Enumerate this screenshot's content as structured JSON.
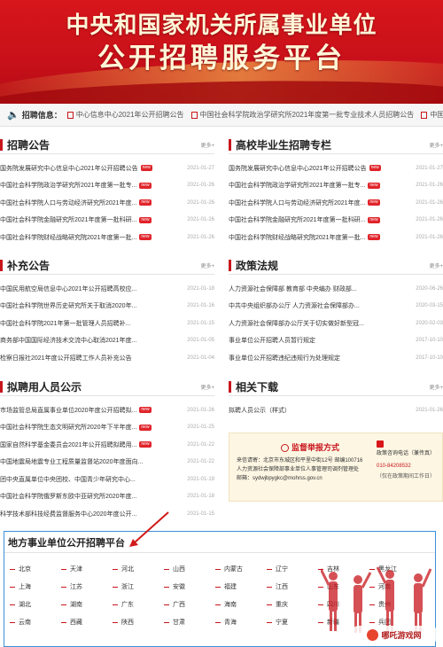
{
  "banner": {
    "line1": "中央和国家机关所属事业单位",
    "line2": "公开招聘服务平台"
  },
  "notice": {
    "label": "招聘信息：",
    "items": [
      "中心信息中心2021年公开招聘公告",
      "中国社会科学院政治学研究所2021年度第一批专业技术人员招聘公告",
      "中国社会科学院人口..."
    ]
  },
  "sections": {
    "recruit": {
      "title": "招聘公告",
      "more": "更多+",
      "rows": [
        {
          "text": "国务院发展研究中心信息中心2021年公开招聘公告",
          "badge": "new",
          "date": "2021-01-27"
        },
        {
          "text": "中国社会科学院政治学研究所2021年度第一批专...",
          "badge": "new",
          "date": "2021-01-26"
        },
        {
          "text": "中国社会科学院人口与劳动经济研究所2021年度...",
          "badge": "new",
          "date": "2021-01-26"
        },
        {
          "text": "中国社会科学院金融研究所2021年度第一批科研...",
          "badge": "new",
          "date": "2021-01-26"
        },
        {
          "text": "中国社会科学院财经战略研究院2021年度第一批...",
          "badge": "new",
          "date": "2021-01-26"
        }
      ]
    },
    "graduate": {
      "title": "高校毕业生招聘专栏",
      "more": "更多+",
      "rows": [
        {
          "text": "国务院发展研究中心信息中心2021年公开招聘公告",
          "badge": "new",
          "date": "2021-01-27"
        },
        {
          "text": "中国社会科学院政治学研究所2021年度第一批专...",
          "badge": "new",
          "date": "2021-01-26"
        },
        {
          "text": "中国社会科学院人口与劳动经济研究所2021年度...",
          "badge": "new",
          "date": "2021-01-26"
        },
        {
          "text": "中国社会科学院金融研究所2021年度第一批科研...",
          "badge": "new",
          "date": "2021-01-26"
        },
        {
          "text": "中国社会科学院财经战略研究院2021年度第一批...",
          "badge": "new",
          "date": "2021-01-26"
        }
      ]
    },
    "supplement": {
      "title": "补充公告",
      "more": "更多+",
      "rows": [
        {
          "text": "中国民用航空局信息中心2021年公开招聘高校应...",
          "badge": "",
          "date": "2021-01-18"
        },
        {
          "text": "中国社会科学院世界历史研究所关于取消2020年...",
          "badge": "",
          "date": "2021-01-16"
        },
        {
          "text": "中国社会科学院2021年第一批管理人员招聘补...",
          "badge": "",
          "date": "2021-01-15"
        },
        {
          "text": "商务部中国国际经济技术交流中心取消2021年度...",
          "badge": "",
          "date": "2021-01-05"
        },
        {
          "text": "检察日报社2021年度公开招聘工作人员补充公告",
          "badge": "",
          "date": "2021-01-04"
        }
      ]
    },
    "policy": {
      "title": "政策法规",
      "more": "更多+",
      "rows": [
        {
          "text": "人力资源社会保障部 教育部 中央编办 财政部...",
          "badge": "",
          "date": "2020-06-26"
        },
        {
          "text": "中共中央组织部办公厅 人力资源社会保障部办...",
          "badge": "",
          "date": "2020-03-15"
        },
        {
          "text": "人力资源社会保障部办公厅关于切实做好新型冠...",
          "badge": "",
          "date": "2020-02-03"
        },
        {
          "text": "事业单位公开招聘人员暂行规定",
          "badge": "",
          "date": "2017-10-10"
        },
        {
          "text": "事业单位公开招聘违纪违规行为处理规定",
          "badge": "",
          "date": "2017-10-10"
        }
      ]
    },
    "candidates": {
      "title": "拟聘用人员公示",
      "more": "更多+",
      "rows": [
        {
          "text": "市场监管总局直属事业单位2020年度公开招聘拟...",
          "badge": "new",
          "date": "2021-01-26"
        },
        {
          "text": "中国社会科学院生态文明研究所2020年下半年度...",
          "badge": "new",
          "date": "2021-01-25"
        },
        {
          "text": "国家自然科学基金委员会2021年公开招聘拟聘用...",
          "badge": "new",
          "date": "2021-01-22"
        },
        {
          "text": "中国地震局地震专业工程质量监督站2020年度面向...",
          "badge": "",
          "date": "2021-01-22"
        },
        {
          "text": "团中央直属单位中央团校、中国青少年研究中心...",
          "badge": "",
          "date": "2021-01-19"
        },
        {
          "text": "中国社会科学院俄罗斯东欧中亚研究所2020年度...",
          "badge": "",
          "date": "2021-01-18"
        },
        {
          "text": "科学技术部科技经费监督服务中心2020年度公开...",
          "badge": "",
          "date": "2021-01-15"
        }
      ]
    },
    "downloads": {
      "title": "相关下载",
      "more": "更多+",
      "rows": [
        {
          "text": "拟聘人员公示（样式）",
          "badge": "",
          "date": "2021-01-26"
        }
      ]
    }
  },
  "supervision": {
    "title": "监督举报方式",
    "lines": [
      "来信请寄：北京市东城区和平里中街12号 邮编100716",
      "人力资源社会保障部事业单位人事管理司调剂管理处",
      "邮箱：sydwjbpygkc@mohrss.gov.cn"
    ],
    "side_heading": "政策咨询电话（兼传真）",
    "phone": "010-84208532",
    "side_note": "（仅在政策期间工作日）"
  },
  "local_platform": {
    "title": "地方事业单位公开招聘平台",
    "regions": [
      "北京",
      "天津",
      "河北",
      "山西",
      "内蒙古",
      "辽宁",
      "吉林",
      "黑龙江",
      "上海",
      "江苏",
      "浙江",
      "安徽",
      "福建",
      "江西",
      "山东",
      "河南",
      "湖北",
      "湖南",
      "广东",
      "广西",
      "海南",
      "重庆",
      "四川",
      "贵州",
      "云南",
      "西藏",
      "陕西",
      "甘肃",
      "青海",
      "宁夏",
      "新疆",
      "兵团"
    ]
  },
  "watermark": {
    "text": "哪吒游戏网"
  },
  "colors": {
    "brand_red": "#c8161d",
    "border_blue": "#3b8fd9",
    "badge_red": "#e0242a"
  }
}
